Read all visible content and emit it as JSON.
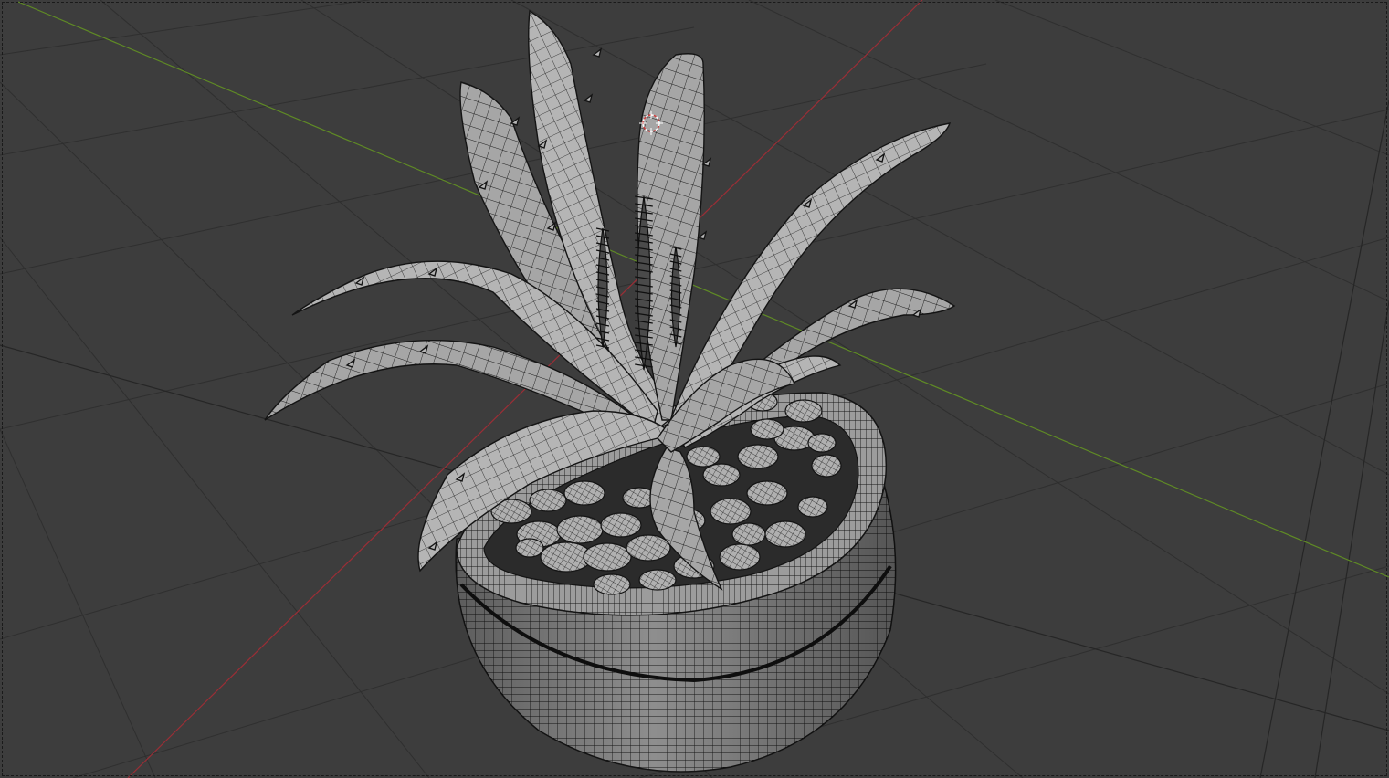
{
  "app": "3D Viewport",
  "viewport": {
    "view": "perspective",
    "background_color": "#3d3d3d",
    "grid_color": "#333333",
    "axis_x_color": "#9a2e36",
    "axis_y_color": "#5f8a25",
    "shading": "wireframe-overlay"
  },
  "scene": {
    "object": "potted-aloe-plant",
    "parts": [
      "aloe-leaves",
      "flower-stalks",
      "pebbles",
      "pot"
    ],
    "mesh_fill": "#a9a9a9",
    "wire_color": "#1c1c1c"
  },
  "origin_marker": {
    "icon": "3d-cursor-icon",
    "colors": [
      "#d23c3c",
      "#ffffff"
    ]
  }
}
